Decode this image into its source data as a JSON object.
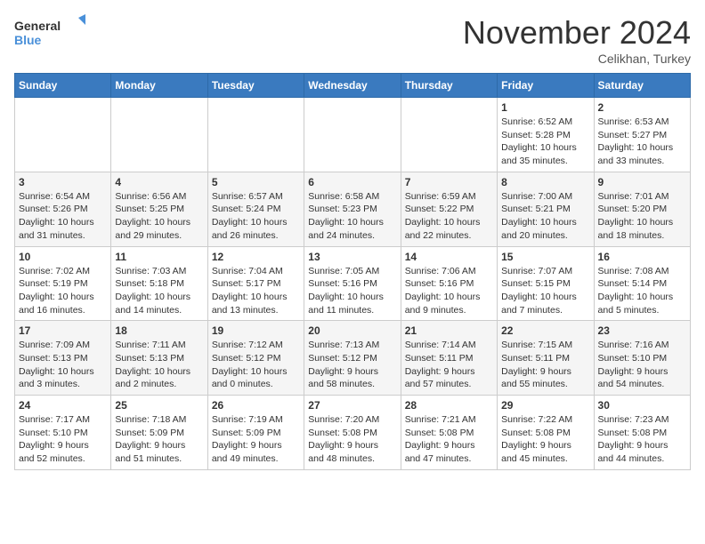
{
  "logo": {
    "line1": "General",
    "line2": "Blue"
  },
  "title": "November 2024",
  "location": "Celikhan, Turkey",
  "weekdays": [
    "Sunday",
    "Monday",
    "Tuesday",
    "Wednesday",
    "Thursday",
    "Friday",
    "Saturday"
  ],
  "weeks": [
    [
      {
        "day": "",
        "info": ""
      },
      {
        "day": "",
        "info": ""
      },
      {
        "day": "",
        "info": ""
      },
      {
        "day": "",
        "info": ""
      },
      {
        "day": "",
        "info": ""
      },
      {
        "day": "1",
        "info": "Sunrise: 6:52 AM\nSunset: 5:28 PM\nDaylight: 10 hours\nand 35 minutes."
      },
      {
        "day": "2",
        "info": "Sunrise: 6:53 AM\nSunset: 5:27 PM\nDaylight: 10 hours\nand 33 minutes."
      }
    ],
    [
      {
        "day": "3",
        "info": "Sunrise: 6:54 AM\nSunset: 5:26 PM\nDaylight: 10 hours\nand 31 minutes."
      },
      {
        "day": "4",
        "info": "Sunrise: 6:56 AM\nSunset: 5:25 PM\nDaylight: 10 hours\nand 29 minutes."
      },
      {
        "day": "5",
        "info": "Sunrise: 6:57 AM\nSunset: 5:24 PM\nDaylight: 10 hours\nand 26 minutes."
      },
      {
        "day": "6",
        "info": "Sunrise: 6:58 AM\nSunset: 5:23 PM\nDaylight: 10 hours\nand 24 minutes."
      },
      {
        "day": "7",
        "info": "Sunrise: 6:59 AM\nSunset: 5:22 PM\nDaylight: 10 hours\nand 22 minutes."
      },
      {
        "day": "8",
        "info": "Sunrise: 7:00 AM\nSunset: 5:21 PM\nDaylight: 10 hours\nand 20 minutes."
      },
      {
        "day": "9",
        "info": "Sunrise: 7:01 AM\nSunset: 5:20 PM\nDaylight: 10 hours\nand 18 minutes."
      }
    ],
    [
      {
        "day": "10",
        "info": "Sunrise: 7:02 AM\nSunset: 5:19 PM\nDaylight: 10 hours\nand 16 minutes."
      },
      {
        "day": "11",
        "info": "Sunrise: 7:03 AM\nSunset: 5:18 PM\nDaylight: 10 hours\nand 14 minutes."
      },
      {
        "day": "12",
        "info": "Sunrise: 7:04 AM\nSunset: 5:17 PM\nDaylight: 10 hours\nand 13 minutes."
      },
      {
        "day": "13",
        "info": "Sunrise: 7:05 AM\nSunset: 5:16 PM\nDaylight: 10 hours\nand 11 minutes."
      },
      {
        "day": "14",
        "info": "Sunrise: 7:06 AM\nSunset: 5:16 PM\nDaylight: 10 hours\nand 9 minutes."
      },
      {
        "day": "15",
        "info": "Sunrise: 7:07 AM\nSunset: 5:15 PM\nDaylight: 10 hours\nand 7 minutes."
      },
      {
        "day": "16",
        "info": "Sunrise: 7:08 AM\nSunset: 5:14 PM\nDaylight: 10 hours\nand 5 minutes."
      }
    ],
    [
      {
        "day": "17",
        "info": "Sunrise: 7:09 AM\nSunset: 5:13 PM\nDaylight: 10 hours\nand 3 minutes."
      },
      {
        "day": "18",
        "info": "Sunrise: 7:11 AM\nSunset: 5:13 PM\nDaylight: 10 hours\nand 2 minutes."
      },
      {
        "day": "19",
        "info": "Sunrise: 7:12 AM\nSunset: 5:12 PM\nDaylight: 10 hours\nand 0 minutes."
      },
      {
        "day": "20",
        "info": "Sunrise: 7:13 AM\nSunset: 5:12 PM\nDaylight: 9 hours\nand 58 minutes."
      },
      {
        "day": "21",
        "info": "Sunrise: 7:14 AM\nSunset: 5:11 PM\nDaylight: 9 hours\nand 57 minutes."
      },
      {
        "day": "22",
        "info": "Sunrise: 7:15 AM\nSunset: 5:11 PM\nDaylight: 9 hours\nand 55 minutes."
      },
      {
        "day": "23",
        "info": "Sunrise: 7:16 AM\nSunset: 5:10 PM\nDaylight: 9 hours\nand 54 minutes."
      }
    ],
    [
      {
        "day": "24",
        "info": "Sunrise: 7:17 AM\nSunset: 5:10 PM\nDaylight: 9 hours\nand 52 minutes."
      },
      {
        "day": "25",
        "info": "Sunrise: 7:18 AM\nSunset: 5:09 PM\nDaylight: 9 hours\nand 51 minutes."
      },
      {
        "day": "26",
        "info": "Sunrise: 7:19 AM\nSunset: 5:09 PM\nDaylight: 9 hours\nand 49 minutes."
      },
      {
        "day": "27",
        "info": "Sunrise: 7:20 AM\nSunset: 5:08 PM\nDaylight: 9 hours\nand 48 minutes."
      },
      {
        "day": "28",
        "info": "Sunrise: 7:21 AM\nSunset: 5:08 PM\nDaylight: 9 hours\nand 47 minutes."
      },
      {
        "day": "29",
        "info": "Sunrise: 7:22 AM\nSunset: 5:08 PM\nDaylight: 9 hours\nand 45 minutes."
      },
      {
        "day": "30",
        "info": "Sunrise: 7:23 AM\nSunset: 5:08 PM\nDaylight: 9 hours\nand 44 minutes."
      }
    ]
  ]
}
